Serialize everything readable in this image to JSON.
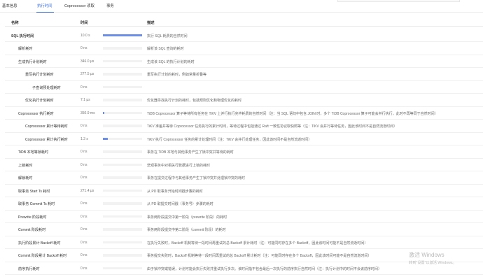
{
  "tabs": [
    {
      "label": "基本信息",
      "active": false
    },
    {
      "label": "执行时间",
      "active": true
    },
    {
      "label": "Coprocessor 读取",
      "active": false
    },
    {
      "label": "事务",
      "active": false
    }
  ],
  "columns": {
    "name": "名称",
    "duration": "时间",
    "description": "描述"
  },
  "accent_color": "#3b6fd8",
  "bar_color": "#6c8ee6",
  "rows": [
    {
      "name": "SQL 执行时间",
      "duration": "10.0 s",
      "bar_fraction": 1.0,
      "description": "执行 SQL 耗费的自然时间"
    },
    {
      "name": "解析耗时",
      "duration": "0 ns",
      "bar_fraction": 0,
      "description": "解析该 SQL 查询的耗时"
    },
    {
      "name": "生成执行计划耗时",
      "duration": "346.0 µs",
      "bar_fraction": 0,
      "description": "生成该 SQL 的执行计划的耗时"
    },
    {
      "name": "重写执行计划耗时",
      "duration": "277.5 µs",
      "bar_fraction": 0,
      "description": "重写执行计划的耗时，例如常量折叠等"
    },
    {
      "name": "子查询预处理耗时",
      "duration": "0 ns",
      "bar_fraction": 0,
      "description": ""
    },
    {
      "name": "优化执行计划耗时",
      "duration": "7.1 µs",
      "bar_fraction": 0,
      "description": "优化器寻找执行计划的耗时，包括规则优化和物理优化的耗时"
    },
    {
      "name": "Coprocessor 执行耗时",
      "duration": "350.9 ms",
      "bar_fraction": 0.035,
      "description": "TiDB Coprocessor 算子等待所有任务在 TiKV 上并行执行完毕耗费的自然时间（注：当 SQL 语句中包含 JOIN 时，多个 TiDB Coprocessor 算子可能会并行执行，此时不再等同于自然时间）"
    },
    {
      "name": "Coprocessor 累计等待耗时",
      "duration": "0 ns",
      "bar_fraction": 0,
      "description": "TiKV 准备并等待 Coprocessor 任务执行的累计时间，等待过程中包括通过 Raft 一致性协议取快照等（注：TiKV 会并行等待任务，因此该时间不是自然流逝时间）"
    },
    {
      "name": "Coprocessor 累计执行耗时",
      "duration": "1.3 s",
      "bar_fraction": 0.13,
      "description": "TiKV 执行 Coprocessor 任务的累计处理时间（注：TiKV 会并行处理任务，因此该时间不是自然流逝时间）"
    },
    {
      "name": "TiDB 本地等锁耗时",
      "duration": "0 ns",
      "bar_fraction": 0,
      "description": "事务在 TiDB 本地与其他事务产生了锁冲突并等待的耗时"
    },
    {
      "name": "上锁耗时",
      "duration": "0 ns",
      "bar_fraction": 0,
      "description": "悲观事务中对相关行数据进行上锁的耗时"
    },
    {
      "name": "解锁耗时",
      "duration": "0 ns",
      "bar_fraction": 0,
      "description": "事务在提交过程中与其他事务产生了锁冲突并处理锁冲突的耗时"
    },
    {
      "name": "取事务 Start Ts 耗时",
      "duration": "271.4 µs",
      "bar_fraction": 0,
      "description": "从 PD 取事务开始时间戳步骤的耗时"
    },
    {
      "name": "取事务 Commit Ts 耗时",
      "duration": "0 ns",
      "bar_fraction": 0,
      "description": "从 PD 取提交时间戳（事务号）步骤的耗时"
    },
    {
      "name": "Prewrite 阶段耗时",
      "duration": "0 ns",
      "bar_fraction": 0,
      "description": "事务两阶段提交中第一阶段（prewrite 阶段）的耗时"
    },
    {
      "name": "Commit 阶段耗时",
      "duration": "0 ns",
      "bar_fraction": 0,
      "description": "事务两阶段提交中第二阶段（commit 阶段）的耗时"
    },
    {
      "name": "执行阶段累计 Backoff 耗时",
      "duration": "0 ns",
      "bar_fraction": 0,
      "description": "在执行失败时，Backoff 机制等待一段时间再重试的总 Backoff 累计耗时（注：可能同时存在多个 Backoff，因此该时间可能不是自然流逝时间）"
    },
    {
      "name": "Commit 阶段累计 Backoff 耗时",
      "duration": "0 ns",
      "bar_fraction": 0,
      "description": "事务提交失败时，Backoff 机制等待一段时间再重试的总 Backoff 累计耗时（注：可能同时存在多个 Backoff，因此该时间可能不是自然流逝时间）"
    },
    {
      "name": "前序执行耗时",
      "duration": "0 ns",
      "bar_fraction": 0,
      "description": "由于锁冲突或错误，计划可能会执行失败并重试执行多次。该时间指不包含最后一次执行的前序执行自然时间（注：执行计划中的时间不会该前序时间）"
    }
  ],
  "watermark": {
    "title": "激活 Windows",
    "subtitle": "转到\"设置\"以激活 Windows。"
  }
}
